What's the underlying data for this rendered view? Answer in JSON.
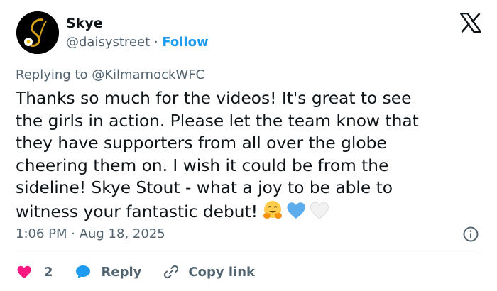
{
  "user": {
    "name": "Skye",
    "handle": "@daisystreet",
    "separator": " · ",
    "follow_label": "Follow"
  },
  "reply_context": {
    "prefix": "Replying to ",
    "mention": "@KilmarnockWFC"
  },
  "tweet": {
    "lines": [
      "Thanks so much for the videos! It's great to see",
      "the girls in action. Please let the team know that",
      "they have supporters from all over the globe",
      "cheering them on. I wish it could be from the",
      "sideline! Skye Stout - what a joy to be able to",
      "witness your fantastic debut!"
    ],
    "emojis": [
      "hugging-face-emoji",
      "light-blue-heart-emoji",
      "white-heart-emoji"
    ]
  },
  "meta": {
    "timestamp": "1:06 PM · Aug 18, 2025"
  },
  "actions": {
    "like_count": "2",
    "reply_label": "Reply",
    "copy_link_label": "Copy link"
  },
  "colors": {
    "text": "#0f1419",
    "secondary": "#536471",
    "accent": "#1d9bf0",
    "like": "#f91880",
    "divider": "#eff3f4"
  },
  "icons": {
    "platform_logo": "x-logo-icon",
    "info": "info-icon",
    "like": "heart-icon",
    "reply": "speech-bubble-icon",
    "copy_link": "link-icon"
  }
}
